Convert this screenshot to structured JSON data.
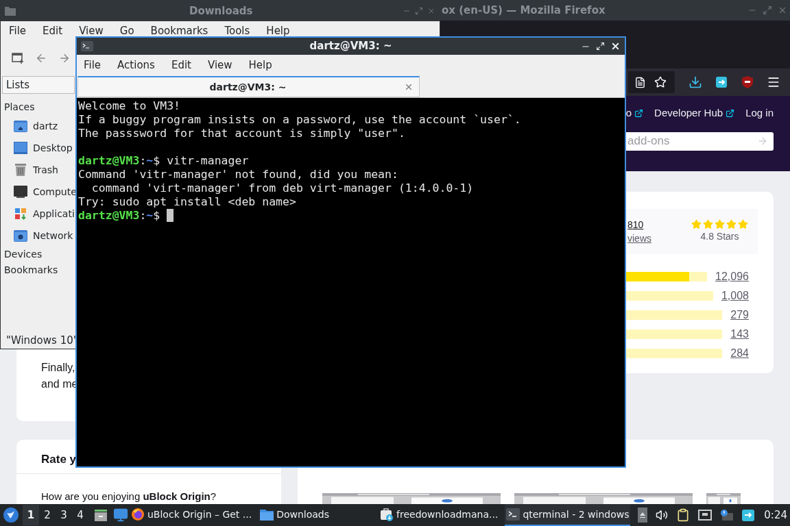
{
  "firefox": {
    "title": "ox (en-US) — Mozilla Firefox",
    "header_links": [
      {
        "label": "o",
        "external": true
      },
      {
        "label": "Developer Hub",
        "external": true
      },
      {
        "label": "Log in",
        "external": false
      }
    ],
    "search": {
      "placeholder": "add-ons"
    },
    "ratings": {
      "count": "810",
      "reviews_link": "views",
      "stars": 5,
      "stars_label": "4.8 Stars",
      "bars": [
        {
          "level": 0.78,
          "count": "12,096"
        },
        {
          "count": "1,008"
        },
        {
          "count": "279"
        },
        {
          "count": "143"
        },
        {
          "count": "284"
        }
      ]
    },
    "intro_lines": [
      "Finally,",
      "and me"
    ],
    "rate_card": {
      "title": "Rate y",
      "question": "How are you enjoying **uBlock Origin**?"
    },
    "screenshots": [
      {
        "kind": "picture"
      },
      {
        "kind": "picture"
      },
      {
        "kind": "picture"
      }
    ]
  },
  "file_manager": {
    "title": "Downloads",
    "menu": [
      "File",
      "Edit",
      "View",
      "Go",
      "Bookmarks",
      "Tools",
      "Help"
    ],
    "sidebar_mode": "Lists",
    "sections": [
      {
        "label": "Places",
        "items": [
          {
            "label": "dartz",
            "kind": "home"
          },
          {
            "label": "Desktop",
            "kind": "desktop"
          },
          {
            "label": "Trash",
            "kind": "trash"
          },
          {
            "label": "Compute",
            "kind": "computer"
          },
          {
            "label": "Applicati",
            "kind": "apps"
          },
          {
            "label": "Network",
            "kind": "network"
          }
        ]
      },
      {
        "label": "Devices"
      },
      {
        "label": "Bookmarks"
      }
    ],
    "status": "\"Windows 10\""
  },
  "terminal": {
    "title": "dartz@VM3: ~",
    "menu": [
      "File",
      "Actions",
      "Edit",
      "View",
      "Help"
    ],
    "tabs": [
      {
        "label": "dartz@VM3: ~",
        "selected": true
      }
    ],
    "lines": [
      {
        "segments": [
          {
            "kind": "text",
            "text": "Welcome to VM3!"
          }
        ]
      },
      {
        "segments": [
          {
            "kind": "text",
            "text": "If a buggy program insists on a password, use the account `user`."
          }
        ]
      },
      {
        "segments": [
          {
            "kind": "text",
            "text": "The passsword for that account is simply \"user\"."
          }
        ]
      },
      {
        "kind": "blank"
      },
      {
        "segments": [
          {
            "kind": "user",
            "text": "dartz@VM3"
          },
          {
            "kind": "text",
            "text": ":"
          },
          {
            "kind": "path",
            "text": "~"
          },
          {
            "kind": "text",
            "text": "$ vitr-manager"
          }
        ]
      },
      {
        "segments": [
          {
            "kind": "text",
            "text": "Command 'vitr-manager' not found, did you mean:"
          }
        ]
      },
      {
        "segments": [
          {
            "kind": "text",
            "text": "  command 'virt-manager' from deb virt-manager (1:4.0.0-1)"
          }
        ]
      },
      {
        "segments": [
          {
            "kind": "text",
            "text": "Try: sudo apt install <deb name>"
          }
        ]
      },
      {
        "segments": [
          {
            "kind": "user",
            "text": "dartz@VM3"
          },
          {
            "kind": "text",
            "text": ":"
          },
          {
            "kind": "path",
            "text": "~"
          },
          {
            "kind": "text",
            "text": "$ "
          }
        ]
      }
    ],
    "cursor": true
  },
  "taskbar": {
    "desktops": [
      {
        "label": "1",
        "selected": true
      },
      {
        "label": "2",
        "selected": false
      },
      {
        "label": "3",
        "selected": false
      },
      {
        "label": "4",
        "selected": false
      }
    ],
    "tasks": [
      {
        "label": "uBlock Origin – Get ...",
        "kind": "browser",
        "selected": false
      },
      {
        "label": "Downloads",
        "kind": "folder",
        "selected": false
      },
      {
        "label": "freedownloadmana...",
        "kind": "download-manager",
        "selected": false
      },
      {
        "label": "qterminal - 2 windows",
        "kind": "terminal",
        "selected": true
      }
    ],
    "clock": "0:24"
  }
}
